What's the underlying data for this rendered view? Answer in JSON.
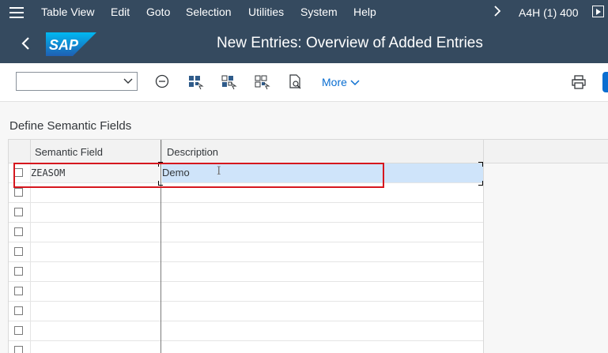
{
  "menubar": {
    "items": [
      "Table View",
      "Edit",
      "Goto",
      "Selection",
      "Utilities",
      "System",
      "Help"
    ],
    "system_info": "A4H (1) 400"
  },
  "titlebar": {
    "logo_text": "SAP",
    "title": "New Entries: Overview of Added Entries"
  },
  "toolbar": {
    "combo_value": "",
    "more_label": "More"
  },
  "section": {
    "title": "Define Semantic Fields"
  },
  "table": {
    "columns": [
      "Semantic Field",
      "Description"
    ],
    "rows": [
      {
        "semantic_field": "ZEASOM",
        "description": "Demo"
      },
      {
        "semantic_field": "",
        "description": ""
      },
      {
        "semantic_field": "",
        "description": ""
      },
      {
        "semantic_field": "",
        "description": ""
      },
      {
        "semantic_field": "",
        "description": ""
      },
      {
        "semantic_field": "",
        "description": ""
      },
      {
        "semantic_field": "",
        "description": ""
      },
      {
        "semantic_field": "",
        "description": ""
      },
      {
        "semantic_field": "",
        "description": ""
      },
      {
        "semantic_field": "",
        "description": ""
      }
    ]
  },
  "colors": {
    "shell": "#354a5f",
    "accent": "#0a6ed1",
    "selected_cell": "#cfe4fa",
    "highlight": "#d6171e"
  },
  "icons": [
    "menu-icon",
    "back-icon",
    "cancel-icon",
    "select-all-icon",
    "deselect-icon",
    "select-block-icon",
    "details-icon",
    "print-icon",
    "play-icon",
    "chevron-right-icon"
  ]
}
